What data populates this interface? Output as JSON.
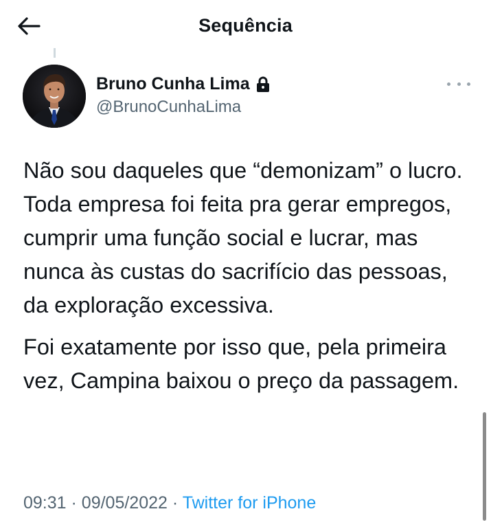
{
  "header": {
    "title": "Sequência",
    "back_icon": "arrow-left-icon"
  },
  "author": {
    "name": "Bruno Cunha Lima",
    "handle": "@BrunoCunhaLima",
    "protected_icon": "lock-icon",
    "more_icon": "more-horizontal-icon"
  },
  "tweet": {
    "paragraphs": [
      "Não sou daqueles que “demonizam” o lucro. Toda empresa foi feita pra gerar empregos, cumprir uma função social e lucrar, mas nunca às custas do sacrifício das pessoas, da exploração excessiva.",
      "Foi exatamente por isso que, pela primeira vez, Campina baixou o preço da passagem."
    ],
    "time": "09:31",
    "date": "09/05/2022",
    "separator": "·",
    "source": "Twitter for iPhone"
  },
  "colors": {
    "text": "#0f1419",
    "secondary": "#536471",
    "link": "#1d9bf0"
  }
}
